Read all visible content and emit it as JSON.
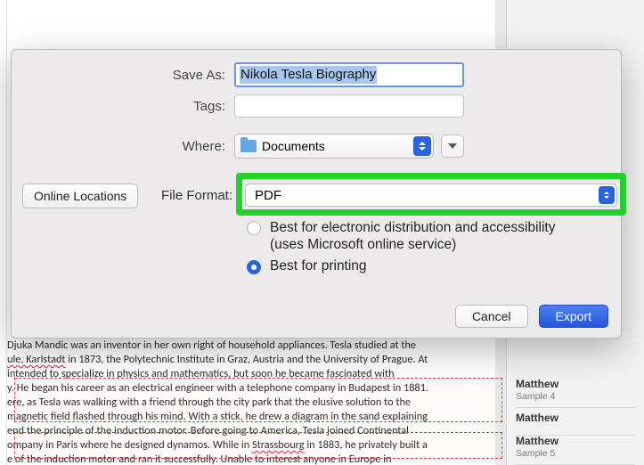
{
  "dialog": {
    "saveAsLabel": "Save As:",
    "filename": "Nikola Tesla Biography",
    "tagsLabel": "Tags:",
    "tagsValue": "",
    "whereLabel": "Where:",
    "whereValue": "Documents",
    "onlineLocations": "Online Locations",
    "fileFormatLabel": "File Format:",
    "fileFormatValue": "PDF",
    "optionElectronic": "Best for electronic distribution and accessibility (uses Microsoft online service)",
    "optionPrinting": "Best for printing",
    "cancel": "Cancel",
    "export": "Export"
  },
  "sidebar": {
    "entries": [
      {
        "name": "Matthew",
        "sub": "Sample 4"
      },
      {
        "name": "Matthew",
        "sub": ""
      },
      {
        "name": "Matthew",
        "sub": "Sample 5"
      }
    ]
  },
  "document": {
    "lines": [
      "Djuka Mandic was an inventor in her own right of household appliances. Tesla studied at the",
      "ule, Karlstadt in 1873, the Polytechnic Institute in Graz, Austria and the University of Prague. At",
      "intended to specialize in physics and mathematics, but soon he became fascinated with",
      "y. He began his career as an electrical engineer with a telephone company in Budapest in 1881.",
      "ere, as Tesla was walking with a friend through the city park that the elusive solution to the",
      "magnetic field flashed through his mind. With a stick, he drew a diagram in the sand explaining",
      "end the principle of the induction motor. Before going to America, Tesla joined Continental",
      "ompany in Paris where he designed dynamos. While in Strassbourg in 1883, he privately built a",
      "e of the induction motor and ran it successfully. Unable to interest anyone in Europe in"
    ]
  }
}
